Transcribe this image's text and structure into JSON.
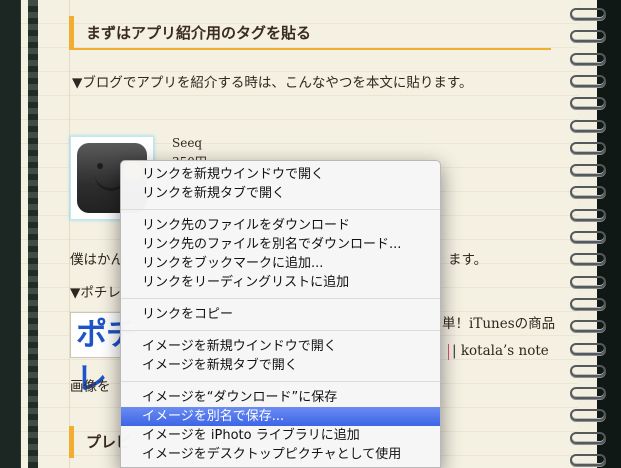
{
  "section1": {
    "heading": "まずはアプリ紹介用のタグを貼る",
    "intro": "▼ブログでアプリを紹介する時は、こんなやつを本文に貼ります。"
  },
  "app": {
    "name": "Seeq",
    "price_partial": "350円"
  },
  "body": {
    "line_left": "僕はかん",
    "line_right": "ます。",
    "pochi_label": "▼ポチレ",
    "banner_text": "ポチレ",
    "banner_tagline": "iTunesの商品",
    "banner_suffix_left": "単！iTunesの商品",
    "kotala_link": "| kotala’s note",
    "image_label": "画像を"
  },
  "section2": {
    "heading": "プレビ"
  },
  "context_menu": {
    "groups": [
      [
        "リンクを新規ウインドウで開く",
        "リンクを新規タブで開く"
      ],
      [
        "リンク先のファイルをダウンロード",
        "リンク先のファイルを別名でダウンロード...",
        "リンクをブックマークに追加...",
        "リンクをリーディングリストに追加"
      ],
      [
        "リンクをコピー"
      ],
      [
        "イメージを新規ウインドウで開く",
        "イメージを新規タブで開く"
      ],
      [
        "イメージを“ダウンロード”に保存",
        "イメージを別名で保存...",
        "イメージを iPhoto ライブラリに追加",
        "イメージをデスクトップピクチャとして使用"
      ]
    ],
    "selected": "イメージを別名で保存..."
  },
  "colors": {
    "accent": "#f2ad2f",
    "selection": "#3d65e6",
    "paper": "#f4f0e2",
    "banner_blue": "#1d54c9"
  }
}
